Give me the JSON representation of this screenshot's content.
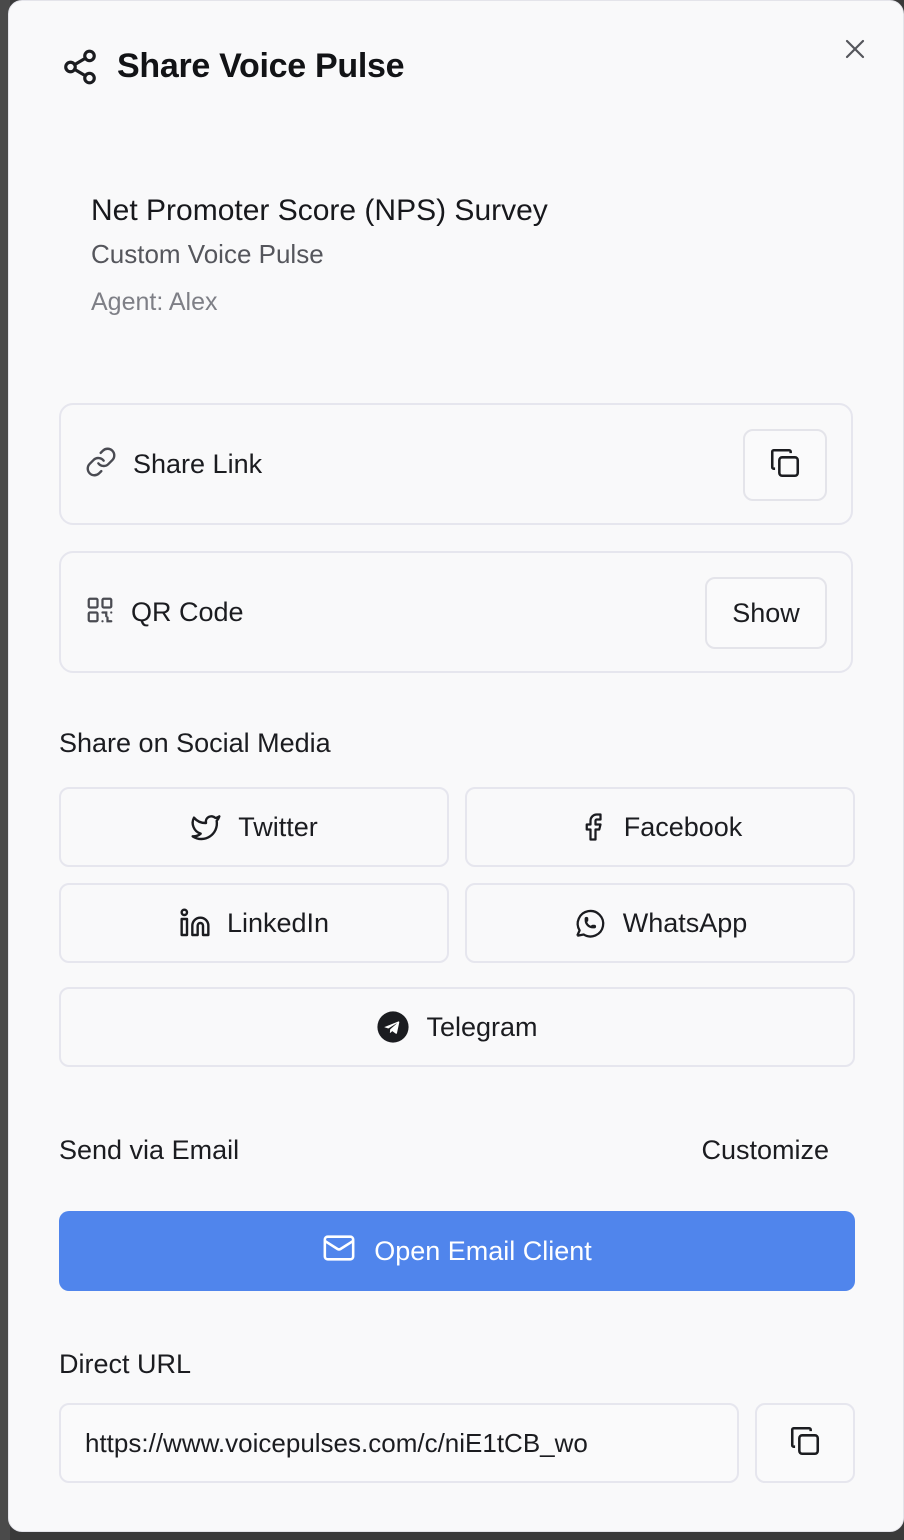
{
  "dialog": {
    "title": "Share Voice Pulse",
    "header_icon": "share-icon",
    "close_icon": "close-icon"
  },
  "survey": {
    "title": "Net Promoter Score (NPS) Survey",
    "subtitle": "Custom Voice Pulse",
    "agent": "Agent: Alex"
  },
  "share_link": {
    "label": "Share Link",
    "icon": "link-icon",
    "copy_icon": "copy-icon"
  },
  "qr_code": {
    "label": "QR Code",
    "icon": "qr-code-icon",
    "button_label": "Show"
  },
  "social": {
    "heading": "Share on Social Media",
    "buttons": [
      {
        "label": "Twitter",
        "icon": "twitter-icon"
      },
      {
        "label": "Facebook",
        "icon": "facebook-icon"
      },
      {
        "label": "LinkedIn",
        "icon": "linkedin-icon"
      },
      {
        "label": "WhatsApp",
        "icon": "whatsapp-icon"
      },
      {
        "label": "Telegram",
        "icon": "telegram-icon"
      }
    ]
  },
  "email": {
    "heading": "Send via Email",
    "customize_label": "Customize",
    "button_label": "Open Email Client",
    "button_icon": "mail-icon",
    "accent_color": "#5085ec"
  },
  "direct_url": {
    "heading": "Direct URL",
    "value": "https://www.voicepulses.com/c/niE1tCB_wo",
    "copy_icon": "copy-icon"
  }
}
